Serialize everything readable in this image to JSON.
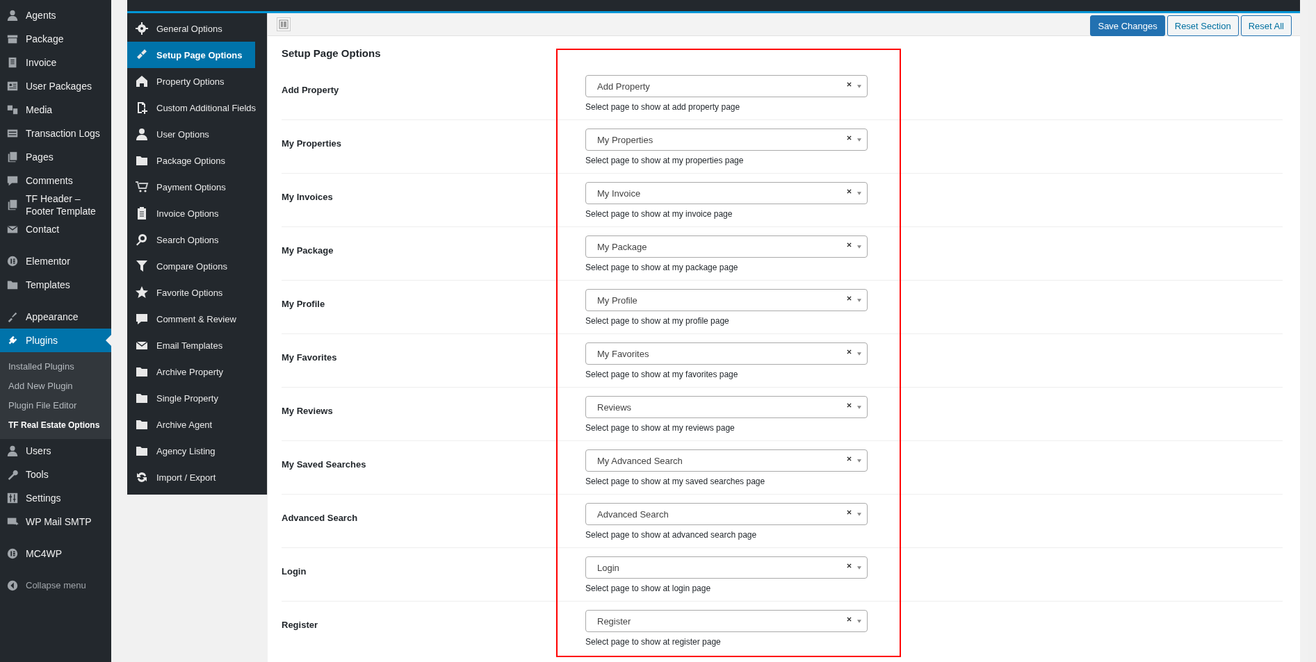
{
  "admin_menu": {
    "items": [
      {
        "label": "Agents",
        "selected": false
      },
      {
        "label": "Package",
        "selected": false
      },
      {
        "label": "Invoice",
        "selected": false
      },
      {
        "label": "User Packages",
        "selected": false
      },
      {
        "label": "Media",
        "selected": false
      },
      {
        "label": "Transaction Logs",
        "selected": false
      },
      {
        "label": "Pages",
        "selected": false
      },
      {
        "label": "Comments",
        "selected": false
      },
      {
        "label": "TF Header – Footer Template",
        "selected": false
      },
      {
        "label": "Contact",
        "selected": false
      },
      {
        "label": "Elementor",
        "selected": false,
        "separator_before": true
      },
      {
        "label": "Templates",
        "selected": false
      },
      {
        "label": "Appearance",
        "selected": false,
        "separator_before": true
      },
      {
        "label": "Plugins",
        "selected": true,
        "submenu": [
          {
            "label": "Installed Plugins",
            "selected": false
          },
          {
            "label": "Add New Plugin",
            "selected": false
          },
          {
            "label": "Plugin File Editor",
            "selected": false
          },
          {
            "label": "TF Real Estate Options",
            "selected": true
          }
        ]
      },
      {
        "label": "Users",
        "selected": false
      },
      {
        "label": "Tools",
        "selected": false
      },
      {
        "label": "Settings",
        "selected": false
      },
      {
        "label": "WP Mail SMTP",
        "selected": false
      },
      {
        "label": "MC4WP",
        "selected": false,
        "separator_before": true
      }
    ],
    "collapse": "Collapse menu"
  },
  "options_nav": [
    {
      "label": "General Options",
      "selected": false
    },
    {
      "label": "Setup Page Options",
      "selected": true
    },
    {
      "label": "Property Options",
      "selected": false
    },
    {
      "label": "Custom Additional Fields",
      "selected": false
    },
    {
      "label": "User Options",
      "selected": false
    },
    {
      "label": "Package Options",
      "selected": false
    },
    {
      "label": "Payment Options",
      "selected": false
    },
    {
      "label": "Invoice Options",
      "selected": false
    },
    {
      "label": "Search Options",
      "selected": false
    },
    {
      "label": "Compare Options",
      "selected": false
    },
    {
      "label": "Favorite Options",
      "selected": false
    },
    {
      "label": "Comment & Review",
      "selected": false
    },
    {
      "label": "Email Templates",
      "selected": false
    },
    {
      "label": "Archive Property",
      "selected": false
    },
    {
      "label": "Single Property",
      "selected": false
    },
    {
      "label": "Archive Agent",
      "selected": false
    },
    {
      "label": "Agency Listing",
      "selected": false
    },
    {
      "label": "Import / Export",
      "selected": false
    }
  ],
  "toolbar_buttons": [
    {
      "label": "Save Changes",
      "kind": "primary"
    },
    {
      "label": "Reset Section",
      "kind": "secondary"
    },
    {
      "label": "Reset All",
      "kind": "secondary"
    }
  ],
  "section_title": "Setup Page Options",
  "fields": [
    {
      "label": "Add Property",
      "value": "Add Property",
      "description": "Select page to show at add property page"
    },
    {
      "label": "My Properties",
      "value": "My Properties",
      "description": "Select page to show at my properties page"
    },
    {
      "label": "My Invoices",
      "value": "My Invoice",
      "description": "Select page to show at my invoice page"
    },
    {
      "label": "My Package",
      "value": "My Package",
      "description": "Select page to show at my package page"
    },
    {
      "label": "My Profile",
      "value": "My Profile",
      "description": "Select page to show at my profile page"
    },
    {
      "label": "My Favorites",
      "value": "My Favorites",
      "description": "Select page to show at my favorites page"
    },
    {
      "label": "My Reviews",
      "value": "Reviews",
      "description": "Select page to show at my reviews page"
    },
    {
      "label": "My Saved Searches",
      "value": "My Advanced Search",
      "description": "Select page to show at my saved searches page"
    },
    {
      "label": "Advanced Search",
      "value": "Advanced Search",
      "description": "Select page to show at advanced search page"
    },
    {
      "label": "Login",
      "value": "Login",
      "description": "Select page to show at login page"
    },
    {
      "label": "Register",
      "value": "Register",
      "description": "Select page to show at register page"
    }
  ]
}
